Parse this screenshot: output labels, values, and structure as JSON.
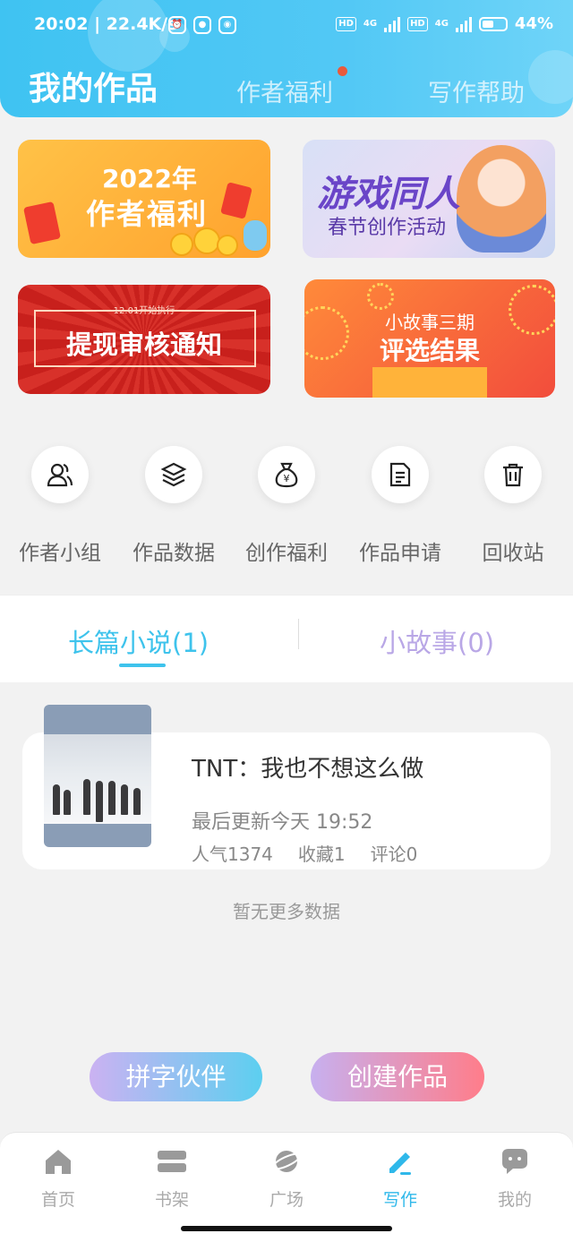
{
  "status": {
    "time": "20:02",
    "speed": "22.4K/s",
    "hd1": "HD",
    "net1": "4G",
    "hd2": "HD",
    "net2": "4G",
    "battery": "44%"
  },
  "header": {
    "title": "我的作品",
    "tabs": [
      "作者福利",
      "写作帮助"
    ]
  },
  "banners": {
    "b1_year": "2022年",
    "b1_title": "作者福利",
    "b2_title": "游戏同人",
    "b2_sub": "春节创作活动",
    "b3_small": "12.01开始执行",
    "b3_title": "提现审核通知",
    "b4_line1": "小故事三期",
    "b4_line2": "评选结果"
  },
  "actions": [
    {
      "label": "作者小组",
      "icon": "group-icon"
    },
    {
      "label": "作品数据",
      "icon": "layers-icon"
    },
    {
      "label": "创作福利",
      "icon": "money-bag-icon"
    },
    {
      "label": "作品申请",
      "icon": "document-icon"
    },
    {
      "label": "回收站",
      "icon": "trash-icon"
    }
  ],
  "tabs": {
    "novel": "长篇小说(1)",
    "story": "小故事(0)"
  },
  "work": {
    "title": "TNT：我也不想这么做",
    "updated": "最后更新今天 19:52",
    "popularity": "人气1374",
    "favorites": "收藏1",
    "comments": "评论0"
  },
  "empty_note": "暂无更多数据",
  "buttons": {
    "partner": "拼字伙伴",
    "create": "创建作品"
  },
  "nav": [
    {
      "label": "首页",
      "icon": "home-icon"
    },
    {
      "label": "书架",
      "icon": "bookshelf-icon"
    },
    {
      "label": "广场",
      "icon": "planet-icon"
    },
    {
      "label": "写作",
      "icon": "pen-icon"
    },
    {
      "label": "我的",
      "icon": "chat-bubble-icon"
    }
  ],
  "colors": {
    "accent": "#3ec3ec",
    "header": "#4fc7f4",
    "nav_active": "#2fb8ea"
  }
}
